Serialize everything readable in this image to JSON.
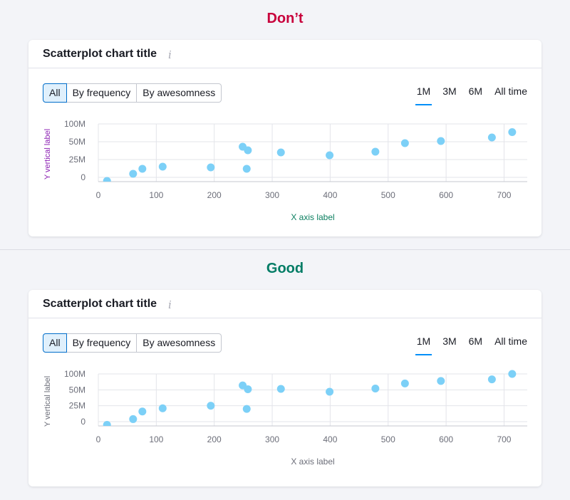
{
  "dont": {
    "heading": "Don’t",
    "card": {
      "title": "Scatterplot chart title",
      "info_icon": "info-icon",
      "filters": [
        "All",
        "By frequency",
        "By awesomness"
      ],
      "active_filter": "All",
      "periods": [
        "1M",
        "3M",
        "6M",
        "All time"
      ],
      "active_period": "1M"
    },
    "label_color": "#8b1fb3",
    "xlabel_color": "#0d8061"
  },
  "good": {
    "heading": "Good",
    "card": {
      "title": "Scatterplot chart title",
      "info_icon": "info-icon",
      "filters": [
        "All",
        "By frequency",
        "By awesomness"
      ],
      "active_filter": "All",
      "periods": [
        "1M",
        "3M",
        "6M",
        "All time"
      ],
      "active_period": "1M"
    },
    "label_color": "#6c6e79",
    "xlabel_color": "#6c6e79"
  },
  "colors": {
    "bad_heading": "#c8003c",
    "good_heading": "#007c65",
    "point": "#7cd0f7",
    "accent": "#008ff8"
  },
  "chart_data": [
    {
      "type": "scatter",
      "title": "Scatterplot chart title",
      "xlabel": "X axis label",
      "ylabel": "Y vertical label",
      "xlim": [
        0,
        740
      ],
      "ylim": [
        -5,
        100
      ],
      "x_ticks": [
        "0",
        "100",
        "200",
        "300",
        "400",
        "500",
        "600",
        "700"
      ],
      "y_ticks": [
        "0",
        "25M",
        "50M",
        "100M"
      ],
      "grid": true,
      "points": [
        {
          "x": 15,
          "y": -5
        },
        {
          "x": 60,
          "y": 5
        },
        {
          "x": 76,
          "y": 12
        },
        {
          "x": 111,
          "y": 15
        },
        {
          "x": 194,
          "y": 14
        },
        {
          "x": 249,
          "y": 43
        },
        {
          "x": 258,
          "y": 38
        },
        {
          "x": 256,
          "y": 12
        },
        {
          "x": 315,
          "y": 35
        },
        {
          "x": 399,
          "y": 31
        },
        {
          "x": 478,
          "y": 36
        },
        {
          "x": 529,
          "y": 48
        },
        {
          "x": 591,
          "y": 52
        },
        {
          "x": 679,
          "y": 62
        },
        {
          "x": 714,
          "y": 77
        }
      ]
    },
    {
      "type": "scatter",
      "title": "Scatterplot chart title",
      "xlabel": "X axis label",
      "ylabel": "Y vertical label",
      "xlim": [
        0,
        740
      ],
      "ylim": [
        -5,
        100
      ],
      "x_ticks": [
        "0",
        "100",
        "200",
        "300",
        "400",
        "500",
        "600",
        "700"
      ],
      "y_ticks": [
        "0",
        "25M",
        "50M",
        "100M"
      ],
      "grid": true,
      "points": [
        {
          "x": 15,
          "y": -5
        },
        {
          "x": 60,
          "y": 4
        },
        {
          "x": 76,
          "y": 16
        },
        {
          "x": 111,
          "y": 21
        },
        {
          "x": 194,
          "y": 25
        },
        {
          "x": 249,
          "y": 64
        },
        {
          "x": 258,
          "y": 52
        },
        {
          "x": 256,
          "y": 20
        },
        {
          "x": 315,
          "y": 53
        },
        {
          "x": 399,
          "y": 47
        },
        {
          "x": 478,
          "y": 54
        },
        {
          "x": 529,
          "y": 70
        },
        {
          "x": 591,
          "y": 78
        },
        {
          "x": 679,
          "y": 83
        },
        {
          "x": 714,
          "y": 100
        }
      ]
    }
  ]
}
